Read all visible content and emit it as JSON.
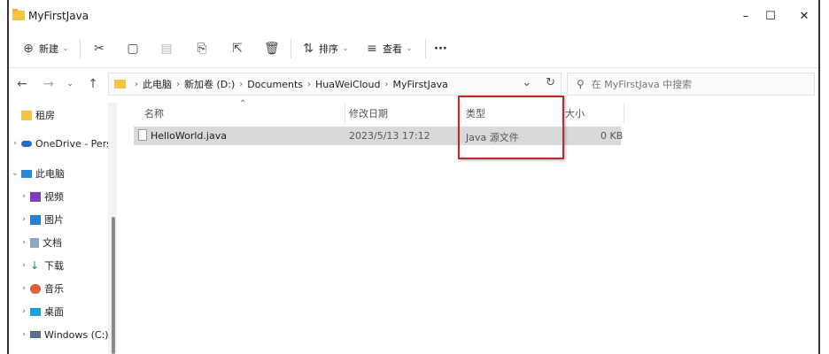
{
  "window": {
    "title": "MyFirstJava",
    "minimize": "–",
    "maximize": "☐",
    "close": "✕"
  },
  "toolbar": {
    "new_label": "新建",
    "sort_label": "排序",
    "view_label": "查看",
    "more_label": "···"
  },
  "address": {
    "crumbs": [
      "此电脑",
      "新加卷 (D:)",
      "Documents",
      "HuaWeiCloud",
      "MyFirstJava"
    ]
  },
  "search": {
    "placeholder": "在 MyFirstJava 中搜索"
  },
  "nav": {
    "items": [
      {
        "label": "租房"
      },
      {
        "label": "OneDrive - Pers"
      },
      {
        "label": "此电脑"
      },
      {
        "label": "视频"
      },
      {
        "label": "图片"
      },
      {
        "label": "文档"
      },
      {
        "label": "下载"
      },
      {
        "label": "音乐"
      },
      {
        "label": "桌面"
      },
      {
        "label": "Windows (C:)"
      }
    ]
  },
  "columns": {
    "name": "名称",
    "modified": "修改日期",
    "type": "类型",
    "size": "大小"
  },
  "files": [
    {
      "name": "HelloWorld.java",
      "modified": "2023/5/13 17:12",
      "type": "Java 源文件",
      "size": "0 KB"
    }
  ],
  "colors": {
    "highlight": "#c0282b",
    "folder": "#f4c542",
    "selected_row": "#d9d9d9"
  }
}
